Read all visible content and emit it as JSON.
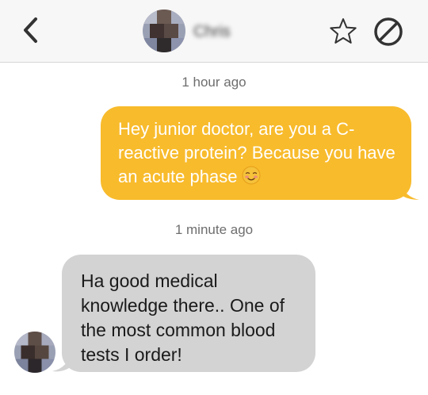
{
  "header": {
    "contact_name": "Chris",
    "back_icon": "chevron-left-icon",
    "star_icon": "star-outline-icon",
    "block_icon": "block-icon"
  },
  "conversation": {
    "messages": [
      {
        "timestamp": "1 hour ago",
        "direction": "outgoing",
        "text": "Hey junior doctor, are you a C-reactive protein? Because you have an acute phase",
        "emoji": "smiling-blush-emoji"
      },
      {
        "timestamp": "1 minute ago",
        "direction": "incoming",
        "text": "Ha good medical knowledge there.. One of the most common blood tests I order!"
      }
    ]
  },
  "colors": {
    "outgoing_bubble": "#f8bb2c",
    "incoming_bubble": "#d3d3d3",
    "header_bg": "#f7f7f7"
  }
}
